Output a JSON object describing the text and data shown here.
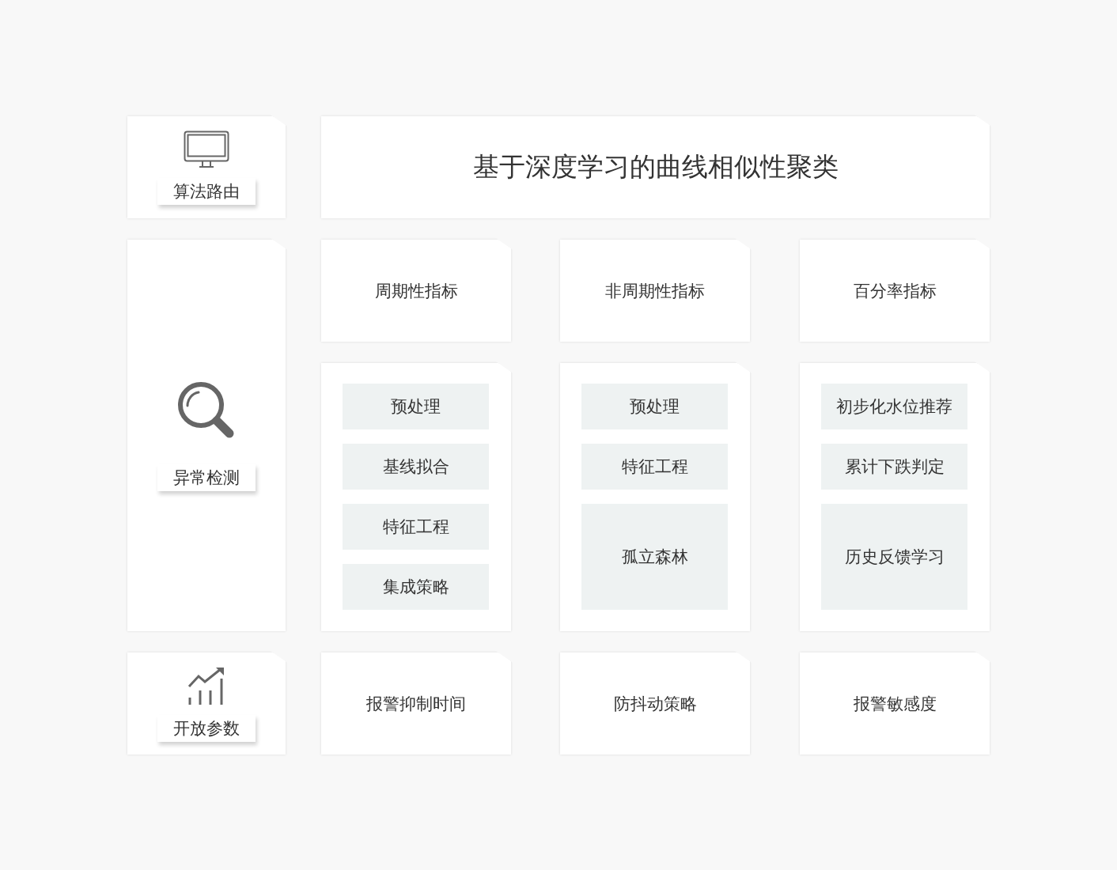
{
  "side_items": [
    {
      "kind": "monitor",
      "label": "算法路由"
    },
    {
      "kind": "search",
      "label": "异常检测"
    },
    {
      "kind": "chart",
      "label": "开放参数"
    }
  ],
  "title": "基于深度学习的曲线相似性聚类",
  "columns": [
    {
      "header": "周期性指标",
      "steps": [
        "预处理",
        "基线拟合",
        "特征工程",
        "集成策略"
      ],
      "parameter": "报警抑制时间"
    },
    {
      "header": "非周期性指标",
      "steps": [
        "预处理",
        "特征工程",
        "孤立森林"
      ],
      "parameter": "防抖动策略"
    },
    {
      "header": "百分率指标",
      "steps": [
        "初步化水位推荐",
        "累计下跌判定",
        "历史反馈学习"
      ],
      "parameter": "报警敏感度"
    }
  ]
}
